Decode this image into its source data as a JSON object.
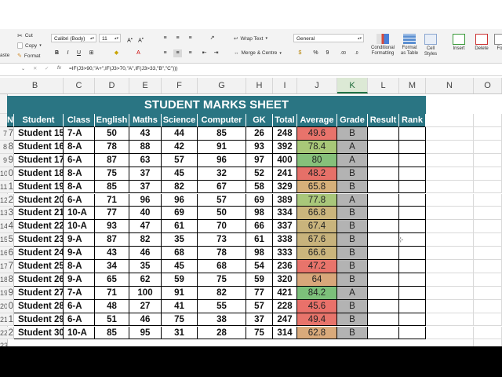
{
  "ribbon": {
    "clipboard": {
      "cut": "Cut",
      "copy": "Copy",
      "format": "Format",
      "paste": "aste"
    },
    "font": {
      "name": "Calibri (Body)",
      "size": "11"
    },
    "alignment": {
      "wrap_text": "Wrap Text",
      "merge_center": "Merge & Centre"
    },
    "number": {
      "format": "General",
      "percent": "%",
      "comma": "9"
    },
    "styles": {
      "conditional": "Conditional Formatting",
      "format_table": "Format as Table",
      "cell_styles": "Cell Styles"
    },
    "cells": {
      "insert": "Insert",
      "delete": "Delete",
      "format": "Fo"
    }
  },
  "formula_bar": {
    "fx": "fx",
    "formula": "=IF(J3>90,\"A+\",IF(J3>70,\"A\",IF(J3>33,\"B\",\"C\")))"
  },
  "columns": [
    "B",
    "C",
    "D",
    "E",
    "F",
    "G",
    "H",
    "I",
    "J",
    "K",
    "L",
    "M",
    "N",
    "O"
  ],
  "row_numbers": [
    "",
    "",
    "7",
    "8",
    "9",
    "10",
    "11",
    "12",
    "13",
    "14",
    "15",
    "16",
    "17",
    "18",
    "19",
    "20",
    "21",
    "22",
    "23"
  ],
  "sheet": {
    "title": "STUDENT MARKS SHEET",
    "headers": [
      "No",
      "Student",
      "Class",
      "English",
      "Maths",
      "Science",
      "Computer",
      "GK",
      "Total",
      "Average",
      "Grade",
      "Result",
      "Rank"
    ],
    "rows": [
      [
        "7",
        "Student 15",
        "7-A",
        "50",
        "43",
        "44",
        "85",
        "26",
        "248",
        "49.6",
        "B"
      ],
      [
        "8",
        "Student 16",
        "8-A",
        "78",
        "88",
        "42",
        "91",
        "93",
        "392",
        "78.4",
        "A"
      ],
      [
        "9",
        "Student 17",
        "6-A",
        "87",
        "63",
        "57",
        "96",
        "97",
        "400",
        "80",
        "A"
      ],
      [
        "0",
        "Student 18",
        "8-A",
        "75",
        "37",
        "45",
        "32",
        "52",
        "241",
        "48.2",
        "B"
      ],
      [
        "1",
        "Student 19",
        "8-A",
        "85",
        "37",
        "82",
        "67",
        "58",
        "329",
        "65.8",
        "B"
      ],
      [
        "2",
        "Student 20",
        "6-A",
        "71",
        "96",
        "96",
        "57",
        "69",
        "389",
        "77.8",
        "A"
      ],
      [
        "3",
        "Student 21",
        "10-A",
        "77",
        "40",
        "69",
        "50",
        "98",
        "334",
        "66.8",
        "B"
      ],
      [
        "4",
        "Student 22",
        "10-A",
        "93",
        "47",
        "61",
        "70",
        "66",
        "337",
        "67.4",
        "B"
      ],
      [
        "5",
        "Student 23",
        "9-A",
        "87",
        "82",
        "35",
        "73",
        "61",
        "338",
        "67.6",
        "B"
      ],
      [
        "6",
        "Student 24",
        "9-A",
        "43",
        "46",
        "68",
        "78",
        "98",
        "333",
        "66.6",
        "B"
      ],
      [
        "7",
        "Student 25",
        "8-A",
        "34",
        "35",
        "45",
        "68",
        "54",
        "236",
        "47.2",
        "B"
      ],
      [
        "8",
        "Student 26",
        "9-A",
        "65",
        "62",
        "59",
        "75",
        "59",
        "320",
        "64",
        "B"
      ],
      [
        "9",
        "Student 27",
        "7-A",
        "71",
        "100",
        "91",
        "82",
        "77",
        "421",
        "84.2",
        "A"
      ],
      [
        "0",
        "Student 28",
        "6-A",
        "48",
        "27",
        "41",
        "55",
        "57",
        "228",
        "45.6",
        "B"
      ],
      [
        "1",
        "Student 29",
        "6-A",
        "51",
        "46",
        "75",
        "38",
        "37",
        "247",
        "49.4",
        "B"
      ],
      [
        "2",
        "Student 30",
        "10-A",
        "85",
        "95",
        "31",
        "28",
        "75",
        "314",
        "62.8",
        "B"
      ]
    ],
    "average_colors": [
      "#e8736b",
      "#a8c878",
      "#86c07a",
      "#e67068",
      "#d6b07a",
      "#a9c77a",
      "#cbb57c",
      "#c9b47c",
      "#c8b37c",
      "#cbb57c",
      "#e8746b",
      "#d8a77a",
      "#7cc07a",
      "#e9716a",
      "#e8746b",
      "#d9aa7b"
    ],
    "grade_color": "#b3b3b3",
    "header_color": "#2a7583"
  }
}
